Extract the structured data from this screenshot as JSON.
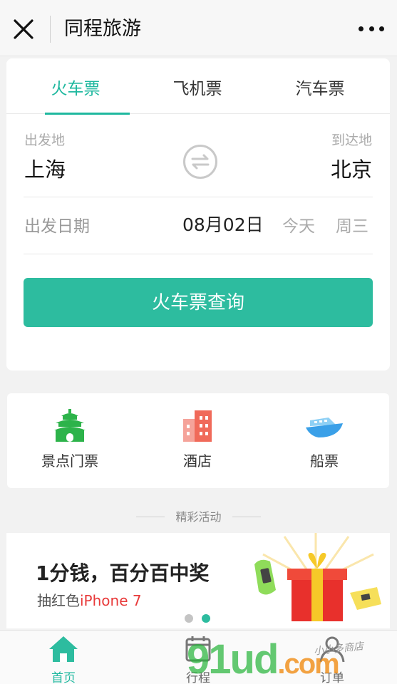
{
  "titlebar": {
    "title": "同程旅游",
    "close_icon": "close-icon",
    "more_icon": "more-dots-icon"
  },
  "tabs": [
    {
      "label": "火车票",
      "active": true
    },
    {
      "label": "飞机票",
      "active": false
    },
    {
      "label": "汽车票",
      "active": false
    }
  ],
  "route": {
    "from_label": "出发地",
    "from_city": "上海",
    "to_label": "到达地",
    "to_city": "北京",
    "swap_icon": "swap-arrows-icon"
  },
  "date": {
    "label": "出发日期",
    "value": "08月02日",
    "today": "今天",
    "weekday": "周三"
  },
  "search_button": "火车票查询",
  "services": [
    {
      "label": "景点门票",
      "icon": "temple-icon",
      "color": "#2db34a"
    },
    {
      "label": "酒店",
      "icon": "hotel-building-icon",
      "color": "#f06a5a"
    },
    {
      "label": "船票",
      "icon": "ship-icon",
      "color": "#3aa0e8"
    }
  ],
  "activities_title": "精彩活动",
  "banner": {
    "title": "1分钱，百分百中奖",
    "subtitle_prefix": "抽红色",
    "subtitle_highlight": "iPhone 7",
    "slide_count": 2,
    "active_slide": 2
  },
  "bottom_nav": [
    {
      "label": "首页",
      "icon": "home-icon",
      "active": true
    },
    {
      "label": "行程",
      "icon": "calendar-icon",
      "active": false
    },
    {
      "label": "订单",
      "icon": "user-icon",
      "active": false
    }
  ],
  "watermark": {
    "text": "91ud",
    "suffix": ".com",
    "script": "小小多商店"
  },
  "colors": {
    "accent": "#1fb89f",
    "button": "#2dbc9f",
    "highlight_red": "#e83a3a"
  }
}
